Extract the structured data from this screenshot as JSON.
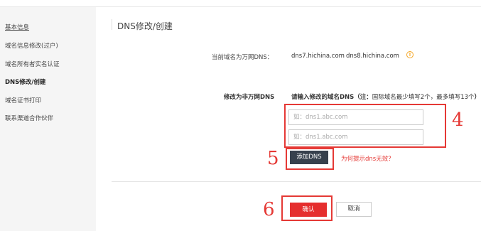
{
  "sidebar": {
    "items": [
      {
        "label": "基本信息"
      },
      {
        "label": "域名信息修改(过户)"
      },
      {
        "label": "域名所有者实名认证"
      },
      {
        "label": "DNS修改/创建"
      },
      {
        "label": "域名证书打印"
      },
      {
        "label": "联系渠道合作伙伴"
      }
    ]
  },
  "main": {
    "title": "DNS修改/创建",
    "current_dns": {
      "label": "当前域名为万网DNS：",
      "dns1": "dns7.hichina.com",
      "dns2": "dns8.hichina.com",
      "info_icon": "!"
    },
    "modify": {
      "label": "修改为非万网DNS",
      "hint_prefix": "请输入修改的域名DNS（注：",
      "hint_note": "国际域名最少填写2个，最多填写13个",
      "hint_suffix": "）",
      "input1_placeholder": "如：dns1.abc.com",
      "input2_placeholder": "如：dns1.abc.com",
      "add_button": "添加DNS",
      "help_link": "为何提示dns无效？"
    },
    "confirm_button": "确认",
    "cancel_button": "取消"
  },
  "annotations": [
    "4",
    "5",
    "6"
  ],
  "colors": {
    "accent_red": "#e52e2e",
    "dark_button": "#37414d",
    "info_orange": "#f5a623"
  }
}
